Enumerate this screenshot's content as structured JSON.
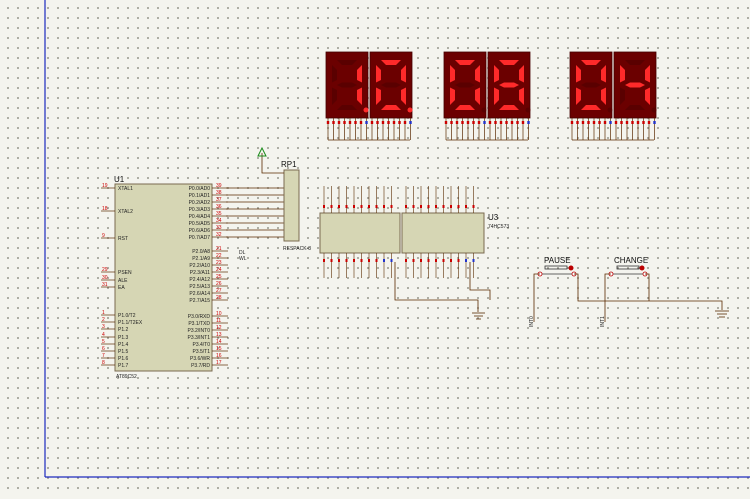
{
  "display": {
    "left_digits": "10",
    "left_dp": true,
    "mid_digits": "08",
    "right_digits": "04",
    "segment_color": "#ff2a2a",
    "body_color": "#6b0000"
  },
  "mcu": {
    "ref": "U1",
    "part": "AT89C52",
    "left_pins": [
      "19",
      "18",
      "9",
      "29",
      "30",
      "31",
      "1",
      "2",
      "3",
      "4",
      "5",
      "6",
      "7",
      "8"
    ],
    "left_labels": [
      "XTAL1",
      "XTAL2",
      "RST",
      "PSEN",
      "ALE",
      "EA",
      "P1.0/T2",
      "P1.1/T2EX",
      "P1.2",
      "P1.3",
      "P1.4",
      "P1.5",
      "P1.6",
      "P1.7"
    ],
    "p0_labels": [
      "P0.0/AD0",
      "P0.1/AD1",
      "P0.2/AD2",
      "P0.3/AD3",
      "P0.4/AD4",
      "P0.5/AD5",
      "P0.6/AD6",
      "P0.7/AD7"
    ],
    "p0_pins": [
      "39",
      "38",
      "37",
      "36",
      "35",
      "34",
      "33",
      "32"
    ],
    "p2_labels": [
      "P2.0/A8",
      "P2.1/A9",
      "P2.2/A10",
      "P2.3/A11",
      "P2.4/A12",
      "P2.5/A13",
      "P2.6/A14",
      "P2.7/A15"
    ],
    "p2_pins": [
      "21",
      "22",
      "23",
      "24",
      "25",
      "26",
      "27",
      "28"
    ],
    "p3_labels": [
      "P3.0/RXD",
      "P3.1/TXD",
      "P3.2/INT0",
      "P3.3/INT1",
      "P3.4/T0",
      "P3.5/T1",
      "P3.6/WR",
      "P3.7/RD"
    ],
    "p3_pins": [
      "10",
      "11",
      "12",
      "13",
      "14",
      "15",
      "16",
      "17"
    ]
  },
  "resnet": {
    "ref": "RP1",
    "part": "RESPACK-8"
  },
  "latch": {
    "ref": "U3",
    "part": "74HC573"
  },
  "buttons": {
    "pause": "PAUSE",
    "change": "CHANGE"
  },
  "net_labels": {
    "mcu_p2": [
      "DL",
      "WL"
    ],
    "mcu_p3": [
      "INT0",
      "INT1"
    ],
    "wl": "WL",
    "dl": "DL",
    "int0": "INT0",
    "int1": "INT1"
  }
}
